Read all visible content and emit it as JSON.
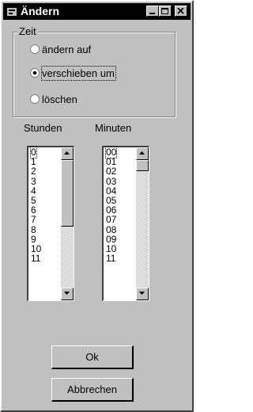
{
  "window": {
    "title": "Ändern"
  },
  "titlebar_buttons": [
    "minimize-icon",
    "maximize-icon",
    "close-icon"
  ],
  "group": {
    "label": "Zeit",
    "options": [
      {
        "label": "ändern auf",
        "selected": false
      },
      {
        "label": "verschieben um",
        "selected": true
      },
      {
        "label": "löschen",
        "selected": false
      }
    ]
  },
  "hours": {
    "label": "Stunden",
    "items": [
      "0",
      "1",
      "2",
      "3",
      "4",
      "5",
      "6",
      "7",
      "8",
      "9",
      "10",
      "11"
    ],
    "selected_index": 0
  },
  "minutes": {
    "label": "Minuten",
    "items": [
      "00",
      "01",
      "02",
      "03",
      "04",
      "05",
      "06",
      "07",
      "08",
      "09",
      "10",
      "11"
    ],
    "selected_index": 0
  },
  "buttons": {
    "ok": "Ok",
    "cancel": "Abbrechen"
  },
  "colors": {
    "face": "#c0c0c0",
    "titlebar": "#000000",
    "title_text": "#ffffff"
  }
}
